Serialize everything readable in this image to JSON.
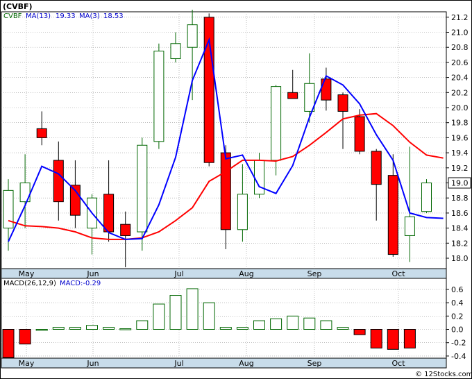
{
  "title": "(CVBF)",
  "watermark": "© 12Stocks.com",
  "colors": {
    "up_fill": "#ffffff",
    "up_stroke": "#006600",
    "down_fill": "#ff0000",
    "down_stroke": "#000000",
    "ma13": "#ff0000",
    "ma3": "#0000ff",
    "macd_line": "#0000ff",
    "axis_band": "#c8dcea",
    "grid": "#999999"
  },
  "price_panel": {
    "legend": {
      "symbol": "CVBF",
      "ma13_label": "MA(13)",
      "ma13_value": "19.33",
      "ma3_label": "MA(3)",
      "ma3_value": "18.53"
    },
    "last_price_label": "19.0",
    "y_ticks": [
      "18.0",
      "18.2",
      "18.4",
      "18.6",
      "18.8",
      "19.0",
      "19.2",
      "19.4",
      "19.6",
      "19.8",
      "20.0",
      "20.2",
      "20.4",
      "20.6",
      "20.8",
      "21.0",
      "21.2"
    ]
  },
  "macd_panel": {
    "legend": {
      "macd_label": "MACD(26,12,9)",
      "macd_value_label": "MACD:-0.29"
    },
    "y_ticks": [
      "-0.4",
      "-0.2",
      "0.0",
      "0.2",
      "0.4",
      "0.6"
    ]
  },
  "months": [
    "May",
    "Jun",
    "Jul",
    "Aug",
    "Sep",
    "Oct"
  ],
  "chart_data": [
    {
      "type": "candlestick",
      "title": "(CVBF)",
      "ylim": [
        17.85,
        21.4
      ],
      "grid": true,
      "x_axis": "weekly",
      "candles": [
        {
          "o": 18.4,
          "h": 19.05,
          "l": 18.1,
          "c": 18.9
        },
        {
          "o": 18.75,
          "h": 19.38,
          "l": 18.4,
          "c": 19.0
        },
        {
          "o": 19.72,
          "h": 19.95,
          "l": 19.5,
          "c": 19.6
        },
        {
          "o": 19.3,
          "h": 19.55,
          "l": 18.5,
          "c": 18.75
        },
        {
          "o": 18.97,
          "h": 19.3,
          "l": 18.4,
          "c": 18.57
        },
        {
          "o": 18.4,
          "h": 18.85,
          "l": 18.05,
          "c": 18.8
        },
        {
          "o": 18.85,
          "h": 19.3,
          "l": 18.22,
          "c": 18.35
        },
        {
          "o": 18.45,
          "h": 18.62,
          "l": 17.88,
          "c": 18.3
        },
        {
          "o": 18.35,
          "h": 19.6,
          "l": 18.1,
          "c": 19.5
        },
        {
          "o": 19.55,
          "h": 20.85,
          "l": 19.45,
          "c": 20.75
        },
        {
          "o": 20.65,
          "h": 21.0,
          "l": 20.6,
          "c": 20.85
        },
        {
          "o": 20.8,
          "h": 21.3,
          "l": 20.1,
          "c": 21.1
        },
        {
          "o": 21.2,
          "h": 21.25,
          "l": 19.22,
          "c": 19.27
        },
        {
          "o": 19.4,
          "h": 19.5,
          "l": 18.12,
          "c": 18.38
        },
        {
          "o": 18.38,
          "h": 19.25,
          "l": 18.22,
          "c": 18.85
        },
        {
          "o": 18.85,
          "h": 19.4,
          "l": 18.8,
          "c": 19.3
        },
        {
          "o": 19.3,
          "h": 20.3,
          "l": 19.1,
          "c": 20.28
        },
        {
          "o": 20.2,
          "h": 20.5,
          "l": 20.15,
          "c": 20.12
        },
        {
          "o": 19.95,
          "h": 20.72,
          "l": 19.8,
          "c": 20.32
        },
        {
          "o": 20.38,
          "h": 20.53,
          "l": 19.96,
          "c": 20.1
        },
        {
          "o": 20.17,
          "h": 20.2,
          "l": 19.45,
          "c": 19.95
        },
        {
          "o": 19.88,
          "h": 19.98,
          "l": 19.38,
          "c": 19.42
        },
        {
          "o": 19.42,
          "h": 19.45,
          "l": 18.5,
          "c": 18.98
        },
        {
          "o": 19.1,
          "h": 19.38,
          "l": 18.02,
          "c": 18.05
        },
        {
          "o": 18.3,
          "h": 19.48,
          "l": 17.95,
          "c": 18.55
        },
        {
          "o": 18.62,
          "h": 19.05,
          "l": 18.6,
          "c": 19.0
        }
      ],
      "series": [
        {
          "name": "MA(13)",
          "values": [
            18.5,
            18.43,
            18.42,
            18.4,
            18.35,
            18.27,
            18.25,
            18.25,
            18.27,
            18.35,
            18.5,
            18.67,
            19.02,
            19.15,
            19.3,
            19.3,
            19.29,
            19.35,
            19.5,
            19.67,
            19.85,
            19.9,
            19.92,
            19.76,
            19.54,
            19.37,
            19.33
          ]
        },
        {
          "name": "MA(3)",
          "values": [
            18.22,
            18.7,
            19.22,
            19.12,
            18.9,
            18.6,
            18.34,
            18.25,
            18.26,
            18.71,
            19.34,
            20.36,
            20.9,
            19.32,
            19.37,
            18.95,
            18.86,
            19.23,
            19.87,
            20.42,
            20.3,
            20.05,
            19.64,
            19.3,
            18.6,
            18.54,
            18.53
          ]
        }
      ],
      "last_value": 19.0
    },
    {
      "type": "bar",
      "name": "MACD(26,12,9)",
      "last_value": -0.29,
      "ylim": [
        -0.46,
        0.72
      ],
      "values": [
        -0.48,
        -0.22,
        0.0,
        0.03,
        0.03,
        0.06,
        0.03,
        0.01,
        0.13,
        0.38,
        0.51,
        0.61,
        0.4,
        0.03,
        0.03,
        0.13,
        0.16,
        0.2,
        0.17,
        0.13,
        0.03,
        -0.08,
        -0.28,
        -0.3,
        -0.28
      ]
    }
  ]
}
